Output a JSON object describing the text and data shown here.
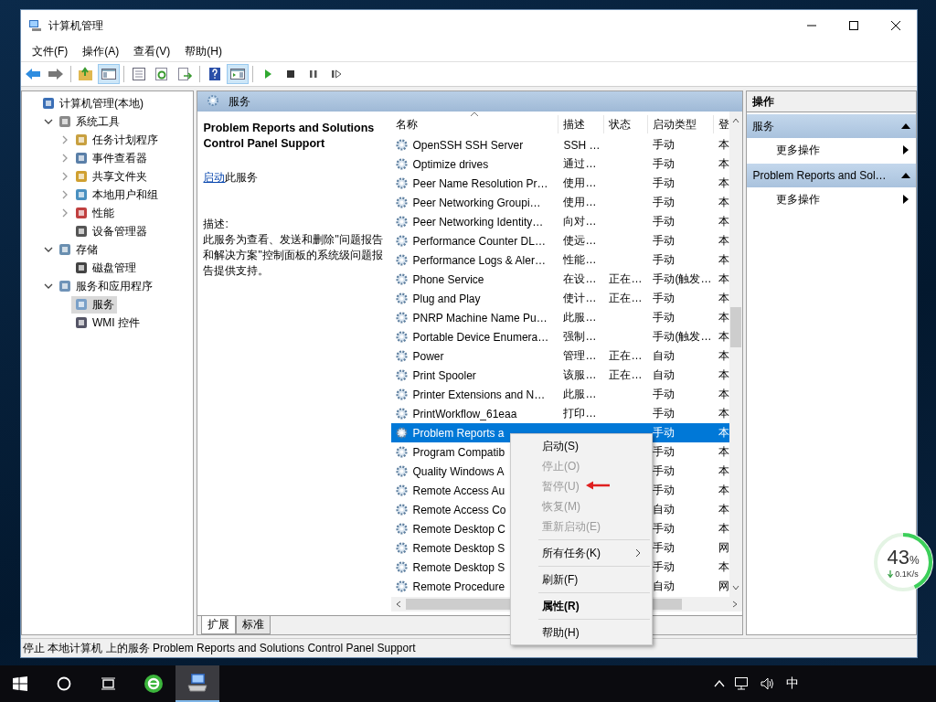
{
  "window": {
    "title": "计算机管理"
  },
  "menu": [
    "文件(F)",
    "操作(A)",
    "查看(V)",
    "帮助(H)"
  ],
  "tree": {
    "items": [
      {
        "label": "计算机管理(本地)",
        "selected": false,
        "children": [
          {
            "label": "系统工具",
            "selected": false,
            "expanded": true,
            "children": [
              {
                "label": "任务计划程序",
                "selected": false,
                "expanded": false
              },
              {
                "label": "事件查看器",
                "selected": false,
                "expanded": false
              },
              {
                "label": "共享文件夹",
                "selected": false,
                "expanded": false
              },
              {
                "label": "本地用户和组",
                "selected": false,
                "expanded": false
              },
              {
                "label": "性能",
                "selected": false,
                "expanded": false
              },
              {
                "label": "设备管理器",
                "selected": false
              }
            ]
          },
          {
            "label": "存储",
            "selected": false,
            "expanded": true,
            "children": [
              {
                "label": "磁盘管理",
                "selected": false
              }
            ]
          },
          {
            "label": "服务和应用程序",
            "selected": false,
            "expanded": true,
            "children": [
              {
                "label": "服务",
                "selected": true
              },
              {
                "label": "WMI 控件",
                "selected": false
              }
            ]
          }
        ]
      }
    ]
  },
  "services": {
    "header": "服务",
    "detail": {
      "title": "Problem Reports and Solutions Control Panel Support",
      "action_link": "启动",
      "action_text": "此服务",
      "description_label": "描述:",
      "description": "此服务为查看、发送和删除\"问题报告和解决方案\"控制面板的系统级问题报告提供支持。"
    },
    "columns": [
      {
        "label": "名称",
        "sorted": true
      },
      {
        "label": "描述",
        "sorted": false
      },
      {
        "label": "状态",
        "sorted": false
      },
      {
        "label": "启动类型",
        "sorted": false
      },
      {
        "label": "登",
        "sorted": false
      }
    ],
    "rows": [
      {
        "name": "OpenSSH SSH Server",
        "description": "SSH …",
        "startup": "手动",
        "column_5": "本",
        "selected": false
      },
      {
        "name": "Optimize drives",
        "description": "通过…",
        "startup": "手动",
        "column_5": "本",
        "selected": false
      },
      {
        "name": "Peer Name Resolution Pr…",
        "description": "使用…",
        "startup": "手动",
        "column_5": "本",
        "selected": false
      },
      {
        "name": "Peer Networking Groupi…",
        "description": "使用…",
        "startup": "手动",
        "column_5": "本",
        "selected": false
      },
      {
        "name": "Peer Networking Identity…",
        "description": "向对…",
        "startup": "手动",
        "column_5": "本",
        "selected": false
      },
      {
        "name": "Performance Counter DL…",
        "description": "使远…",
        "startup": "手动",
        "column_5": "本",
        "selected": false
      },
      {
        "name": "Performance Logs & Aler…",
        "description": "性能…",
        "startup": "手动",
        "column_5": "本",
        "selected": false
      },
      {
        "name": "Phone Service",
        "description": "在设…",
        "status": "正在…",
        "startup": "手动(触发…",
        "column_5": "本",
        "selected": false
      },
      {
        "name": "Plug and Play",
        "description": "使计…",
        "status": "正在…",
        "startup": "手动",
        "column_5": "本",
        "selected": false
      },
      {
        "name": "PNRP Machine Name Pu…",
        "description": "此服…",
        "startup": "手动",
        "column_5": "本",
        "selected": false
      },
      {
        "name": "Portable Device Enumera…",
        "description": "强制…",
        "startup": "手动(触发…",
        "column_5": "本",
        "selected": false
      },
      {
        "name": "Power",
        "description": "管理…",
        "status": "正在…",
        "startup": "自动",
        "column_5": "本",
        "selected": false
      },
      {
        "name": "Print Spooler",
        "description": "该服…",
        "status": "正在…",
        "startup": "自动",
        "column_5": "本",
        "selected": false
      },
      {
        "name": "Printer Extensions and N…",
        "description": "此服…",
        "startup": "手动",
        "column_5": "本",
        "selected": false
      },
      {
        "name": "PrintWorkflow_61eaa",
        "description": "打印…",
        "startup": "手动",
        "column_5": "本",
        "selected": false
      },
      {
        "name": "Problem Reports a",
        "startup": "手动",
        "column_5": "本",
        "selected": true
      },
      {
        "name": "Program Compatib",
        "startup": "手动",
        "column_5": "本",
        "selected": false
      },
      {
        "name": "Quality Windows A",
        "startup": "手动",
        "column_5": "本",
        "selected": false
      },
      {
        "name": "Remote Access Au",
        "startup": "手动",
        "column_5": "本",
        "selected": false
      },
      {
        "name": "Remote Access Co",
        "startup": "自动",
        "column_5": "本",
        "selected": false
      },
      {
        "name": "Remote Desktop C",
        "startup": "手动",
        "column_5": "本",
        "selected": false
      },
      {
        "name": "Remote Desktop S",
        "startup": "手动",
        "column_5": "网",
        "selected": false
      },
      {
        "name": "Remote Desktop S",
        "startup": "手动",
        "column_5": "本",
        "selected": false
      },
      {
        "name": "Remote Procedure",
        "startup": "自动",
        "column_5": "网",
        "selected": false
      }
    ],
    "tabs": [
      {
        "label": "扩展",
        "selected": true
      },
      {
        "label": "标准",
        "selected": false
      }
    ]
  },
  "actions": {
    "title": "操作",
    "sections": [
      {
        "label": "服务",
        "expanded": true,
        "items": [
          "更多操作"
        ]
      },
      {
        "label": "Problem Reports and Sol…",
        "expanded": true,
        "items": [
          "更多操作"
        ]
      }
    ]
  },
  "status_bar": "停止 本地计算机 上的服务 Problem Reports and Solutions Control Panel Support",
  "context_menu": [
    {
      "kind": "item",
      "label": "启动(S)",
      "disabled": false,
      "default": false,
      "submenu": false
    },
    {
      "kind": "item",
      "label": "停止(O)",
      "disabled": true,
      "default": false,
      "submenu": false
    },
    {
      "kind": "item",
      "label": "暂停(U)",
      "disabled": true,
      "default": false,
      "submenu": false
    },
    {
      "kind": "item",
      "label": "恢复(M)",
      "disabled": true,
      "default": false,
      "submenu": false
    },
    {
      "kind": "item",
      "label": "重新启动(E)",
      "disabled": true,
      "default": false,
      "submenu": false
    },
    {
      "kind": "separator"
    },
    {
      "kind": "item",
      "label": "所有任务(K)",
      "disabled": false,
      "default": false,
      "submenu": true
    },
    {
      "kind": "separator"
    },
    {
      "kind": "item",
      "label": "刷新(F)",
      "disabled": false,
      "default": false,
      "submenu": false
    },
    {
      "kind": "separator"
    },
    {
      "kind": "item",
      "label": "属性(R)",
      "disabled": false,
      "default": true,
      "submenu": false
    },
    {
      "kind": "separator"
    },
    {
      "kind": "item",
      "label": "帮助(H)",
      "disabled": false,
      "default": false,
      "submenu": false
    }
  ],
  "speed_widget": {
    "level": 0.43,
    "percent": "43",
    "unit": "%",
    "speed": "0.1K/s"
  },
  "taskbar": {
    "apps": [
      {
        "selected": false
      },
      {
        "selected": true
      }
    ],
    "input_indicator": "中"
  }
}
